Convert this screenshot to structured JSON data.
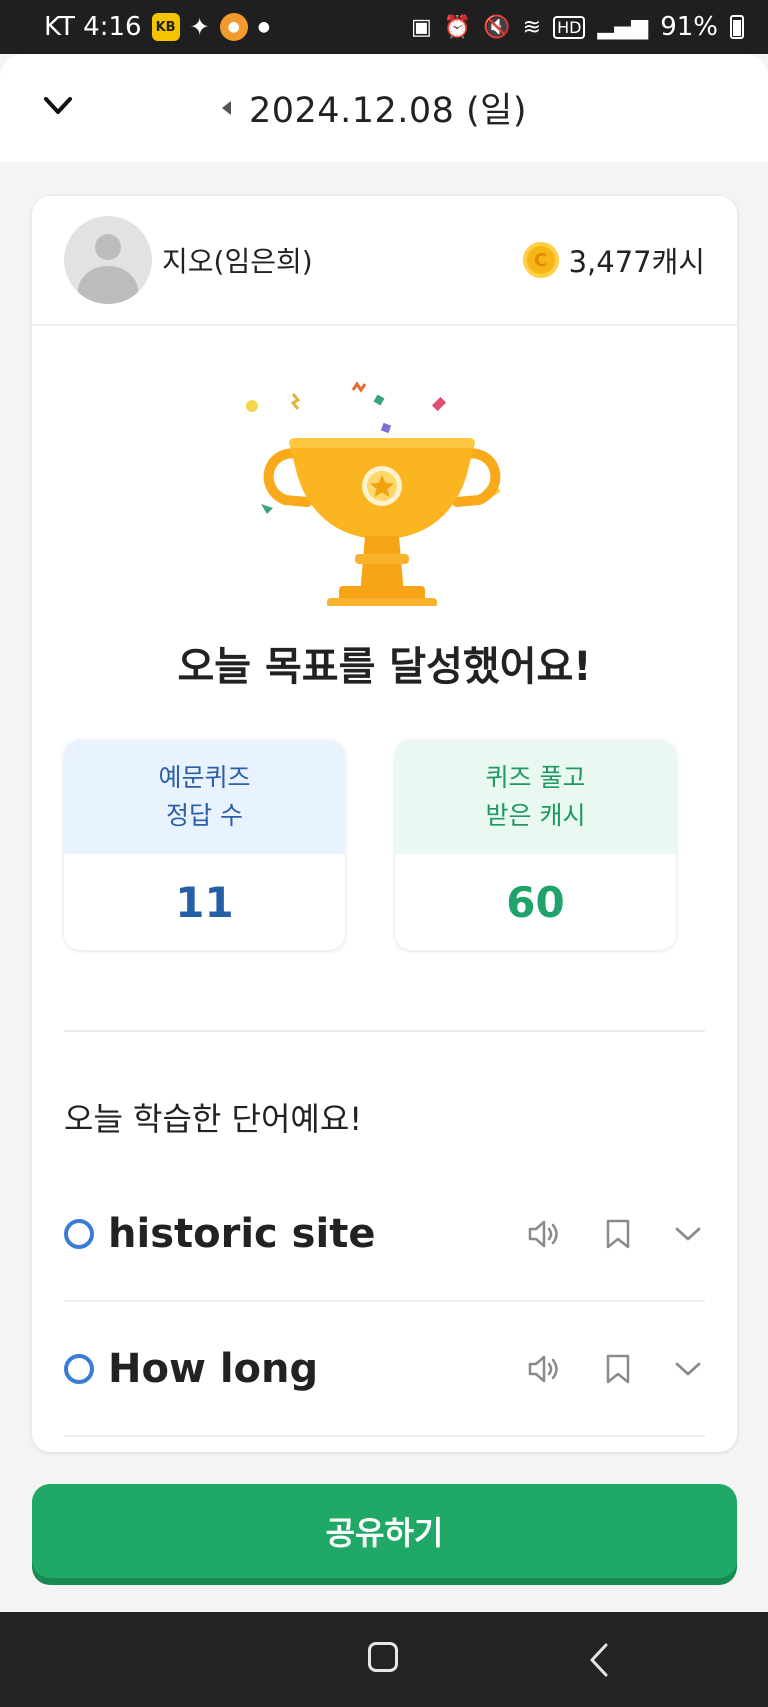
{
  "status_bar": {
    "carrier_time": "KT 4:16",
    "battery": "91%",
    "icons": [
      "kb-app-icon",
      "sparkle-icon",
      "orange-app-icon",
      "notification-dot",
      "screenshot-icon",
      "alarm-icon",
      "mute-icon",
      "wifi-icon",
      "hd-icon",
      "signal-icon",
      "battery-icon"
    ]
  },
  "header": {
    "date": "2024.12.08 (일)"
  },
  "profile": {
    "name": "지오(임은희)",
    "cash": "3,477캐시"
  },
  "main": {
    "goal_title": "오늘 목표를 달성했어요!",
    "stats": [
      {
        "label_line1": "예문퀴즈",
        "label_line2": "정답 수",
        "value": "11"
      },
      {
        "label_line1": "퀴즈 풀고",
        "label_line2": "받은 캐시",
        "value": "60"
      }
    ],
    "words_title": "오늘 학습한 단어예요!",
    "words": [
      {
        "text": "historic site"
      },
      {
        "text": "How long"
      }
    ]
  },
  "footer": {
    "share_label": "공유하기"
  },
  "colors": {
    "accent_green": "#20a866",
    "stat_blue": "#245ea4",
    "stat_green": "#1fa36a",
    "coin": "#f5b515",
    "trophy": "#f9a91a"
  }
}
